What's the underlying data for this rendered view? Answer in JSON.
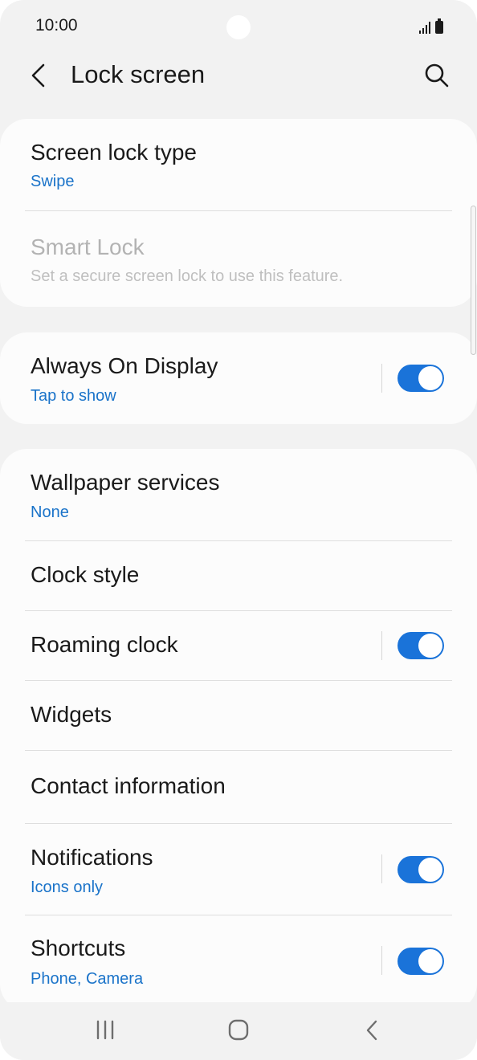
{
  "status_bar": {
    "time": "10:00"
  },
  "header": {
    "title": "Lock screen",
    "back_icon": "chevron-left-icon",
    "search_icon": "search-icon"
  },
  "accent_color": "#1a73c9",
  "card1": {
    "screen_lock_type": {
      "title": "Screen lock type",
      "value": "Swipe"
    },
    "smart_lock": {
      "title": "Smart Lock",
      "subtitle": "Set a secure screen lock to use this feature.",
      "enabled": false
    }
  },
  "card2": {
    "always_on_display": {
      "title": "Always On Display",
      "value": "Tap to show",
      "on": true
    }
  },
  "card3": {
    "wallpaper_services": {
      "title": "Wallpaper services",
      "value": "None"
    },
    "clock_style": {
      "title": "Clock style"
    },
    "roaming_clock": {
      "title": "Roaming clock",
      "on": true
    },
    "widgets": {
      "title": "Widgets"
    },
    "contact_information": {
      "title": "Contact information"
    },
    "notifications": {
      "title": "Notifications",
      "value": "Icons only",
      "on": true
    },
    "shortcuts": {
      "title": "Shortcuts",
      "value": "Phone, Camera",
      "on": true
    }
  },
  "nav_bar": {
    "recents_icon": "recents-icon",
    "home_icon": "home-icon",
    "back_icon": "back-icon"
  }
}
